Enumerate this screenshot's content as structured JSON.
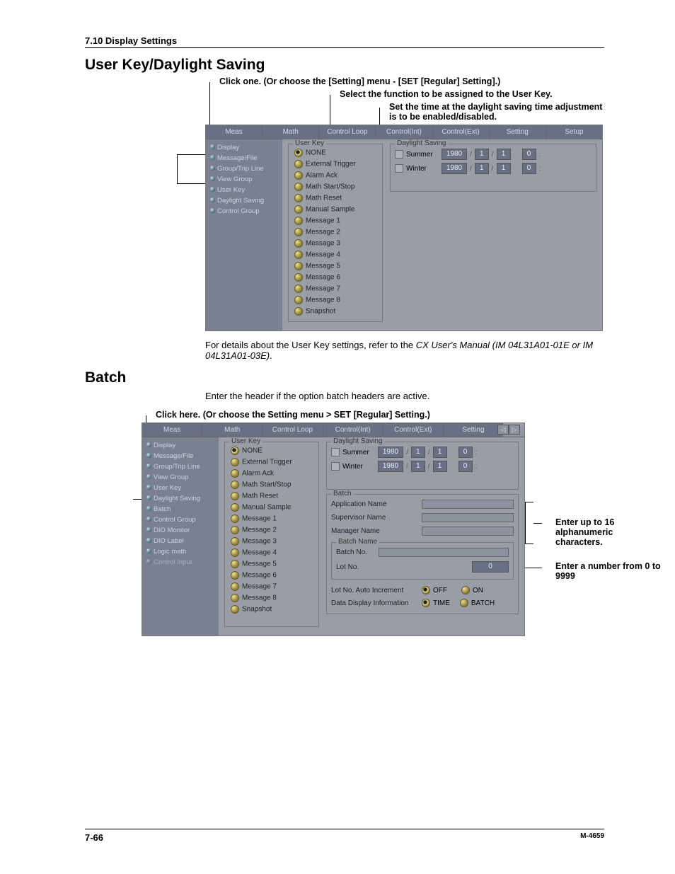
{
  "header": {
    "section": "7.10  Display Settings"
  },
  "sections": {
    "s1": {
      "title": "User Key/Daylight Saving",
      "call1": "Click one. (Or choose the [Setting] menu - [SET [Regular] Setting].)",
      "call2": "Select the function to be assigned to the User Key.",
      "call3": "Set the time at the daylight saving time adjustment is to be enabled/disabled.",
      "body_pre": "For details about the User Key settings, refer to the ",
      "body_italic": "CX User's Manual (IM 04L31A01-01E or IM 04L31A01-03E)",
      "body_post": "."
    },
    "s2": {
      "title": "Batch",
      "body": "Enter the header if the option batch headers are active.",
      "call": "Click here. (Or choose the Setting menu > SET [Regular] Setting.)",
      "note1": "Enter up to 16 alphanumeric characters.",
      "note2": "Enter a number from 0 to 9999"
    }
  },
  "panel1": {
    "tabs": [
      "Meas",
      "Math",
      "Control Loop",
      "Control(Int)",
      "Control(Ext)",
      "Setting",
      "Setup"
    ],
    "sidebar": [
      "Display",
      "Message/File",
      "Group/Trip Line",
      "View Group",
      "User Key",
      "Daylight Saving",
      "Control Group"
    ],
    "userkey": {
      "legend": "User Key",
      "options": [
        "NONE",
        "External Trigger",
        "Alarm Ack",
        "Math Start/Stop",
        "Math Reset",
        "Manual Sample",
        "Message 1",
        "Message 2",
        "Message 3",
        "Message 4",
        "Message 5",
        "Message 6",
        "Message 7",
        "Message 8",
        "Snapshot"
      ]
    },
    "daylight": {
      "legend": "Daylight Saving",
      "rows": [
        {
          "label": "Summer",
          "year": "1980",
          "m": "1",
          "d": "1",
          "h": "0"
        },
        {
          "label": "Winter",
          "year": "1980",
          "m": "1",
          "d": "1",
          "h": "0"
        }
      ]
    }
  },
  "panel2": {
    "tabs": [
      "Meas",
      "Math",
      "Control Loop",
      "Control(Int)",
      "Control(Ext)",
      "Setting"
    ],
    "sidebar": [
      "Display",
      "Message/File",
      "Group/Trip Line",
      "View Group",
      "User Key",
      "Daylight Saving",
      "Batch",
      "Control Group",
      "DIO Monitor",
      "DIO Label",
      "Logic math",
      "Control Input"
    ],
    "userkey": {
      "legend": "User Key",
      "options": [
        "NONE",
        "External Trigger",
        "Alarm Ack",
        "Math Start/Stop",
        "Math Reset",
        "Manual Sample",
        "Message 1",
        "Message 2",
        "Message 3",
        "Message 4",
        "Message 5",
        "Message 6",
        "Message 7",
        "Message 8",
        "Snapshot"
      ]
    },
    "daylight": {
      "legend": "Daylight Saving",
      "rows": [
        {
          "label": "Summer",
          "year": "1980",
          "m": "1",
          "d": "1",
          "h": "0"
        },
        {
          "label": "Winter",
          "year": "1980",
          "m": "1",
          "d": "1",
          "h": "0"
        }
      ]
    },
    "batch": {
      "legend": "Batch",
      "fields": {
        "app": "Application Name",
        "sup": "Supervisor Name",
        "mgr": "Manager Name"
      },
      "bn_legend": "Batch Name",
      "bn_fields": {
        "no": "Batch No.",
        "lot": "Lot No.",
        "lot_val": "0"
      },
      "auto": {
        "label": "Lot No. Auto Increment",
        "off": "OFF",
        "on": "ON"
      },
      "disp": {
        "label": "Data Display Information",
        "time": "TIME",
        "batch": "BATCH"
      }
    }
  },
  "footer": {
    "page": "7-66",
    "doc": "M-4659"
  }
}
